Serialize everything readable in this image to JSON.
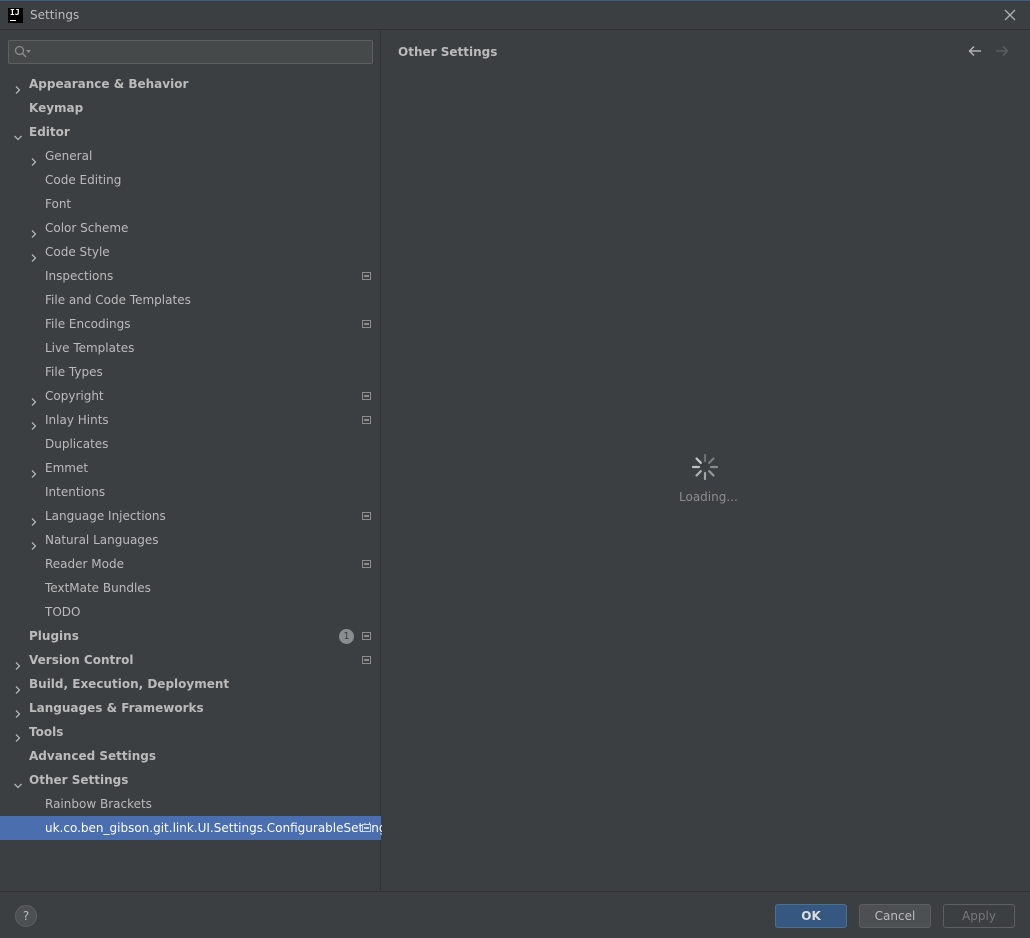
{
  "window": {
    "title": "Settings",
    "app_icon_text": "IJ"
  },
  "search": {
    "placeholder": "",
    "value": ""
  },
  "tree": [
    {
      "label": "Appearance & Behavior",
      "level": 0,
      "expandable": true,
      "expanded": false,
      "modified": false
    },
    {
      "label": "Keymap",
      "level": 0,
      "expandable": false,
      "modified": false
    },
    {
      "label": "Editor",
      "level": 0,
      "expandable": true,
      "expanded": true,
      "modified": false
    },
    {
      "label": "General",
      "level": 1,
      "expandable": true,
      "expanded": false,
      "modified": false
    },
    {
      "label": "Code Editing",
      "level": 1,
      "expandable": false,
      "modified": false
    },
    {
      "label": "Font",
      "level": 1,
      "expandable": false,
      "modified": false
    },
    {
      "label": "Color Scheme",
      "level": 1,
      "expandable": true,
      "expanded": false,
      "modified": false
    },
    {
      "label": "Code Style",
      "level": 1,
      "expandable": true,
      "expanded": false,
      "modified": false
    },
    {
      "label": "Inspections",
      "level": 1,
      "expandable": false,
      "modified": true
    },
    {
      "label": "File and Code Templates",
      "level": 1,
      "expandable": false,
      "modified": false
    },
    {
      "label": "File Encodings",
      "level": 1,
      "expandable": false,
      "modified": true
    },
    {
      "label": "Live Templates",
      "level": 1,
      "expandable": false,
      "modified": false
    },
    {
      "label": "File Types",
      "level": 1,
      "expandable": false,
      "modified": false
    },
    {
      "label": "Copyright",
      "level": 1,
      "expandable": true,
      "expanded": false,
      "modified": true
    },
    {
      "label": "Inlay Hints",
      "level": 1,
      "expandable": true,
      "expanded": false,
      "modified": true
    },
    {
      "label": "Duplicates",
      "level": 1,
      "expandable": false,
      "modified": false
    },
    {
      "label": "Emmet",
      "level": 1,
      "expandable": true,
      "expanded": false,
      "modified": false
    },
    {
      "label": "Intentions",
      "level": 1,
      "expandable": false,
      "modified": false
    },
    {
      "label": "Language Injections",
      "level": 1,
      "expandable": true,
      "expanded": false,
      "modified": true
    },
    {
      "label": "Natural Languages",
      "level": 1,
      "expandable": true,
      "expanded": false,
      "modified": false
    },
    {
      "label": "Reader Mode",
      "level": 1,
      "expandable": false,
      "modified": true
    },
    {
      "label": "TextMate Bundles",
      "level": 1,
      "expandable": false,
      "modified": false
    },
    {
      "label": "TODO",
      "level": 1,
      "expandable": false,
      "modified": false
    },
    {
      "label": "Plugins",
      "level": 0,
      "expandable": false,
      "modified": true,
      "badge": "1"
    },
    {
      "label": "Version Control",
      "level": 0,
      "expandable": true,
      "expanded": false,
      "modified": true
    },
    {
      "label": "Build, Execution, Deployment",
      "level": 0,
      "expandable": true,
      "expanded": false,
      "modified": false
    },
    {
      "label": "Languages & Frameworks",
      "level": 0,
      "expandable": true,
      "expanded": false,
      "modified": false
    },
    {
      "label": "Tools",
      "level": 0,
      "expandable": true,
      "expanded": false,
      "modified": false
    },
    {
      "label": "Advanced Settings",
      "level": 0,
      "expandable": false,
      "modified": false
    },
    {
      "label": "Other Settings",
      "level": 0,
      "expandable": true,
      "expanded": true,
      "modified": false
    },
    {
      "label": "Rainbow Brackets",
      "level": 1,
      "expandable": false,
      "modified": false
    },
    {
      "label": "uk.co.ben_gibson.git.link.UI.Settings.ConfigurableSettings",
      "level": 1,
      "expandable": false,
      "modified": true,
      "selected": true
    }
  ],
  "main": {
    "title": "Other Settings",
    "loading_text": "Loading..."
  },
  "footer": {
    "help_label": "?",
    "ok_label": "OK",
    "cancel_label": "Cancel",
    "apply_label": "Apply"
  },
  "colors": {
    "background": "#3c3f41",
    "selection": "#4b6eaf",
    "primary_button": "#365880"
  }
}
